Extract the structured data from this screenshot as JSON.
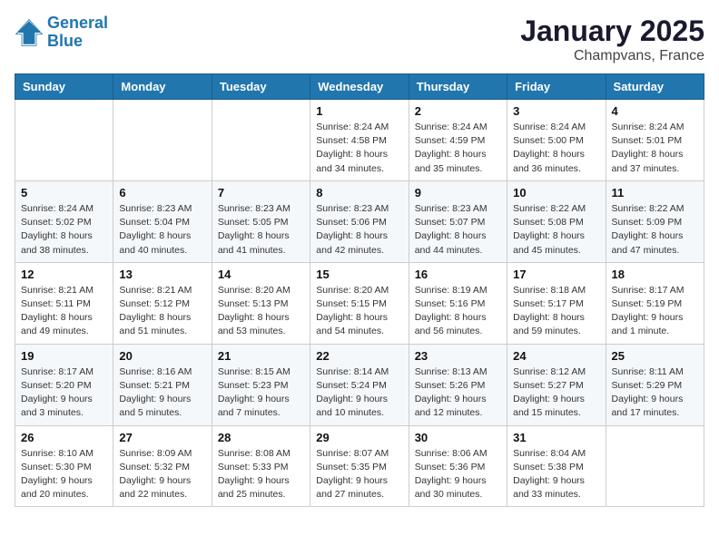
{
  "header": {
    "logo_line1": "General",
    "logo_line2": "Blue",
    "month": "January 2025",
    "location": "Champvans, France"
  },
  "weekdays": [
    "Sunday",
    "Monday",
    "Tuesday",
    "Wednesday",
    "Thursday",
    "Friday",
    "Saturday"
  ],
  "weeks": [
    [
      {
        "day": "",
        "info": ""
      },
      {
        "day": "",
        "info": ""
      },
      {
        "day": "",
        "info": ""
      },
      {
        "day": "1",
        "info": "Sunrise: 8:24 AM\nSunset: 4:58 PM\nDaylight: 8 hours\nand 34 minutes."
      },
      {
        "day": "2",
        "info": "Sunrise: 8:24 AM\nSunset: 4:59 PM\nDaylight: 8 hours\nand 35 minutes."
      },
      {
        "day": "3",
        "info": "Sunrise: 8:24 AM\nSunset: 5:00 PM\nDaylight: 8 hours\nand 36 minutes."
      },
      {
        "day": "4",
        "info": "Sunrise: 8:24 AM\nSunset: 5:01 PM\nDaylight: 8 hours\nand 37 minutes."
      }
    ],
    [
      {
        "day": "5",
        "info": "Sunrise: 8:24 AM\nSunset: 5:02 PM\nDaylight: 8 hours\nand 38 minutes."
      },
      {
        "day": "6",
        "info": "Sunrise: 8:23 AM\nSunset: 5:04 PM\nDaylight: 8 hours\nand 40 minutes."
      },
      {
        "day": "7",
        "info": "Sunrise: 8:23 AM\nSunset: 5:05 PM\nDaylight: 8 hours\nand 41 minutes."
      },
      {
        "day": "8",
        "info": "Sunrise: 8:23 AM\nSunset: 5:06 PM\nDaylight: 8 hours\nand 42 minutes."
      },
      {
        "day": "9",
        "info": "Sunrise: 8:23 AM\nSunset: 5:07 PM\nDaylight: 8 hours\nand 44 minutes."
      },
      {
        "day": "10",
        "info": "Sunrise: 8:22 AM\nSunset: 5:08 PM\nDaylight: 8 hours\nand 45 minutes."
      },
      {
        "day": "11",
        "info": "Sunrise: 8:22 AM\nSunset: 5:09 PM\nDaylight: 8 hours\nand 47 minutes."
      }
    ],
    [
      {
        "day": "12",
        "info": "Sunrise: 8:21 AM\nSunset: 5:11 PM\nDaylight: 8 hours\nand 49 minutes."
      },
      {
        "day": "13",
        "info": "Sunrise: 8:21 AM\nSunset: 5:12 PM\nDaylight: 8 hours\nand 51 minutes."
      },
      {
        "day": "14",
        "info": "Sunrise: 8:20 AM\nSunset: 5:13 PM\nDaylight: 8 hours\nand 53 minutes."
      },
      {
        "day": "15",
        "info": "Sunrise: 8:20 AM\nSunset: 5:15 PM\nDaylight: 8 hours\nand 54 minutes."
      },
      {
        "day": "16",
        "info": "Sunrise: 8:19 AM\nSunset: 5:16 PM\nDaylight: 8 hours\nand 56 minutes."
      },
      {
        "day": "17",
        "info": "Sunrise: 8:18 AM\nSunset: 5:17 PM\nDaylight: 8 hours\nand 59 minutes."
      },
      {
        "day": "18",
        "info": "Sunrise: 8:17 AM\nSunset: 5:19 PM\nDaylight: 9 hours\nand 1 minute."
      }
    ],
    [
      {
        "day": "19",
        "info": "Sunrise: 8:17 AM\nSunset: 5:20 PM\nDaylight: 9 hours\nand 3 minutes."
      },
      {
        "day": "20",
        "info": "Sunrise: 8:16 AM\nSunset: 5:21 PM\nDaylight: 9 hours\nand 5 minutes."
      },
      {
        "day": "21",
        "info": "Sunrise: 8:15 AM\nSunset: 5:23 PM\nDaylight: 9 hours\nand 7 minutes."
      },
      {
        "day": "22",
        "info": "Sunrise: 8:14 AM\nSunset: 5:24 PM\nDaylight: 9 hours\nand 10 minutes."
      },
      {
        "day": "23",
        "info": "Sunrise: 8:13 AM\nSunset: 5:26 PM\nDaylight: 9 hours\nand 12 minutes."
      },
      {
        "day": "24",
        "info": "Sunrise: 8:12 AM\nSunset: 5:27 PM\nDaylight: 9 hours\nand 15 minutes."
      },
      {
        "day": "25",
        "info": "Sunrise: 8:11 AM\nSunset: 5:29 PM\nDaylight: 9 hours\nand 17 minutes."
      }
    ],
    [
      {
        "day": "26",
        "info": "Sunrise: 8:10 AM\nSunset: 5:30 PM\nDaylight: 9 hours\nand 20 minutes."
      },
      {
        "day": "27",
        "info": "Sunrise: 8:09 AM\nSunset: 5:32 PM\nDaylight: 9 hours\nand 22 minutes."
      },
      {
        "day": "28",
        "info": "Sunrise: 8:08 AM\nSunset: 5:33 PM\nDaylight: 9 hours\nand 25 minutes."
      },
      {
        "day": "29",
        "info": "Sunrise: 8:07 AM\nSunset: 5:35 PM\nDaylight: 9 hours\nand 27 minutes."
      },
      {
        "day": "30",
        "info": "Sunrise: 8:06 AM\nSunset: 5:36 PM\nDaylight: 9 hours\nand 30 minutes."
      },
      {
        "day": "31",
        "info": "Sunrise: 8:04 AM\nSunset: 5:38 PM\nDaylight: 9 hours\nand 33 minutes."
      },
      {
        "day": "",
        "info": ""
      }
    ]
  ]
}
